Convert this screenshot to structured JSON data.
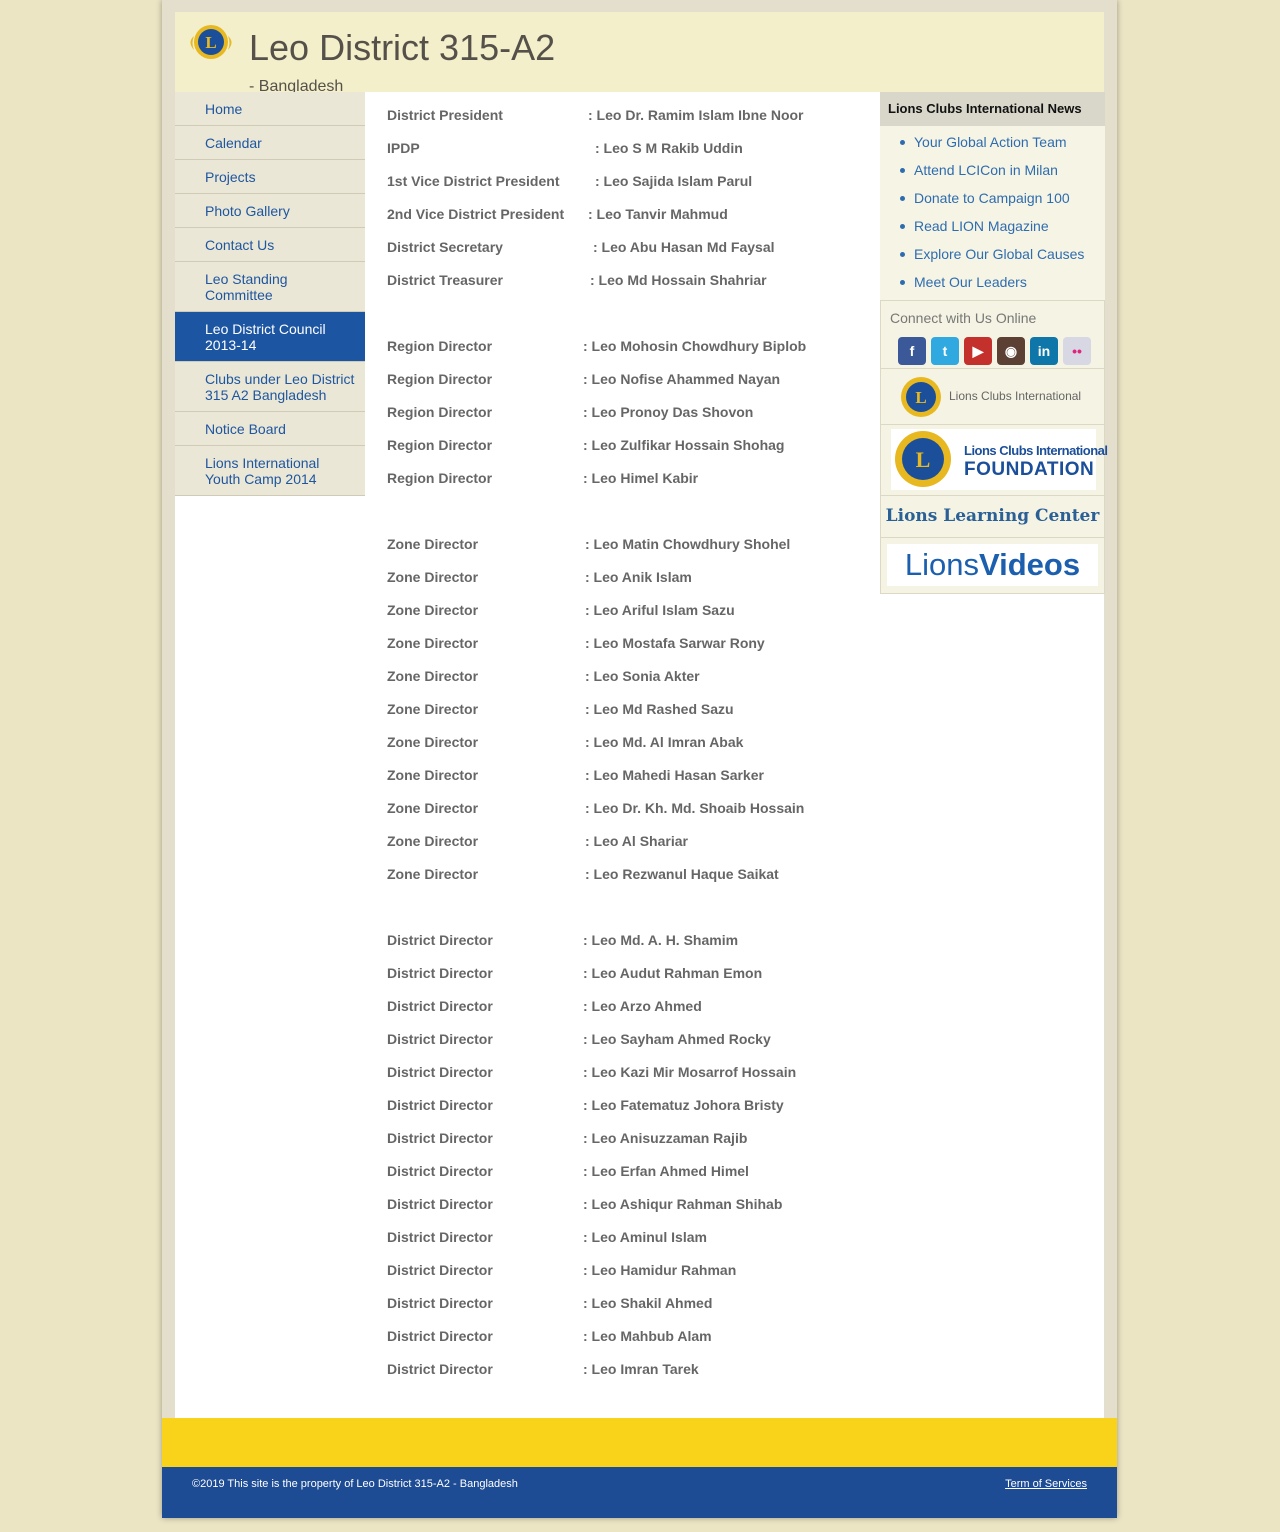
{
  "header": {
    "title": "Leo District 315-A2",
    "subtitle": "- Bangladesh",
    "logo_icon": "lions-clubs-emblem"
  },
  "colors": {
    "header_bg": "#f3efcb",
    "nav_bg": "#eae7d6",
    "nav_active_bg": "#1c55a1",
    "link": "#1f56a0",
    "footer_yellow": "#f9d319",
    "footer_blue": "#1d4b94"
  },
  "nav": {
    "items": [
      {
        "label": "Home"
      },
      {
        "label": "Calendar"
      },
      {
        "label": "Projects"
      },
      {
        "label": "Photo Gallery"
      },
      {
        "label": "Contact Us"
      },
      {
        "label": "Leo Standing Committee"
      },
      {
        "label": "Leo District Council 2013-14",
        "active": true
      },
      {
        "label": "Clubs under Leo District 315 A2 Bangladesh"
      },
      {
        "label": "Notice Board"
      },
      {
        "label": "Lions International Youth Camp 2014"
      }
    ]
  },
  "roster": {
    "groups": [
      [
        {
          "role": "District President",
          "name": ": Leo Dr. Ramim Islam Ibne Noor"
        },
        {
          "role": "IPDP",
          "name": ": Leo S M Rakib Uddin"
        },
        {
          "role": "1st Vice District President",
          "name": ": Leo Sajida Islam Parul"
        },
        {
          "role": "2nd  Vice District President",
          "name": ": Leo Tanvir Mahmud"
        },
        {
          "role": "District Secretary",
          "name": ": Leo Abu Hasan Md Faysal"
        },
        {
          "role": "District Treasurer",
          "name": ": Leo Md Hossain Shahriar"
        }
      ],
      [
        {
          "role": "Region Director",
          "name": ": Leo Mohosin Chowdhury Biplob"
        },
        {
          "role": "Region Director",
          "name": ": Leo Nofise Ahammed Nayan"
        },
        {
          "role": "Region Director",
          "name": ": Leo Pronoy Das Shovon"
        },
        {
          "role": "Region Director",
          "name": ": Leo Zulfikar Hossain Shohag"
        },
        {
          "role": "Region Director",
          "name": ": Leo Himel Kabir"
        }
      ],
      [
        {
          "role": "Zone Director",
          "name": ": Leo Matin Chowdhury Shohel"
        },
        {
          "role": "Zone Director",
          "name": ": Leo Anik Islam"
        },
        {
          "role": "Zone Director",
          "name": ": Leo Ariful Islam Sazu"
        },
        {
          "role": "Zone Director",
          "name": ": Leo Mostafa Sarwar Rony"
        },
        {
          "role": "Zone Director",
          "name": ": Leo Sonia Akter"
        },
        {
          "role": "Zone Director",
          "name": ": Leo Md Rashed Sazu"
        },
        {
          "role": "Zone Director",
          "name": ": Leo Md. Al Imran Abak"
        },
        {
          "role": "Zone Director",
          "name": ": Leo Mahedi Hasan Sarker"
        },
        {
          "role": "Zone Director",
          "name": ": Leo Dr. Kh. Md. Shoaib Hossain"
        },
        {
          "role": "Zone Director",
          "name": ": Leo Al Shariar"
        },
        {
          "role": "Zone Director",
          "name": ": Leo Rezwanul Haque Saikat"
        }
      ],
      [
        {
          "role": "District Director",
          "name": ": Leo Md. A. H. Shamim"
        },
        {
          "role": "District Director",
          "name": ": Leo Audut Rahman Emon"
        },
        {
          "role": "District Director",
          "name": ": Leo Arzo Ahmed"
        },
        {
          "role": "District Director",
          "name": ": Leo Sayham Ahmed Rocky"
        },
        {
          "role": "District Director",
          "name": ": Leo Kazi Mir Mosarrof Hossain"
        },
        {
          "role": "District Director",
          "name": ": Leo Fatematuz Johora Bristy"
        },
        {
          "role": "District Director",
          "name": ": Leo Anisuzzaman Rajib"
        },
        {
          "role": "District Director",
          "name": ": Leo Erfan Ahmed Himel"
        },
        {
          "role": "District Director",
          "name": ": Leo Ashiqur Rahman Shihab"
        },
        {
          "role": "District Director",
          "name": ": Leo Aminul Islam"
        },
        {
          "role": "District Director",
          "name": ": Leo Hamidur Rahman"
        },
        {
          "role": "District Director",
          "name": ": Leo Shakil Ahmed"
        },
        {
          "role": "District Director",
          "name": ": Leo Mahbub Alam"
        },
        {
          "role": "District Director",
          "name": ": Leo Imran Tarek"
        }
      ]
    ]
  },
  "sidebar": {
    "news_heading": "Lions Clubs International News",
    "news": [
      "Your Global Action Team",
      "Attend LCICon in Milan",
      "Donate to Campaign 100",
      "Read LION Magazine",
      "Explore Our Global Causes",
      "Meet Our Leaders"
    ],
    "connect_label": "Connect with Us Online",
    "social": [
      {
        "icon": "facebook-icon",
        "glyph": "f",
        "color": "#3b5998"
      },
      {
        "icon": "twitter-icon",
        "glyph": "t",
        "color": "#2fa9e0"
      },
      {
        "icon": "youtube-icon",
        "glyph": "▶",
        "color": "#c4302b"
      },
      {
        "icon": "instagram-icon",
        "glyph": "◉",
        "color": "#5b4033"
      },
      {
        "icon": "linkedin-icon",
        "glyph": "in",
        "color": "#0e76a8"
      },
      {
        "icon": "flickr-icon",
        "glyph": "••",
        "color": "#d8d8e4"
      }
    ],
    "lci_label": "Lions Clubs International",
    "lcif_line1": "Lions Clubs International",
    "lcif_line2": "FOUNDATION",
    "learning_label": "Lions Learning Center",
    "videos_prefix": "Lions",
    "videos_suffix": "Videos"
  },
  "footer": {
    "copyright": "©2019 This site is the property of Leo District 315-A2 - Bangladesh",
    "terms": "Term of Services"
  }
}
